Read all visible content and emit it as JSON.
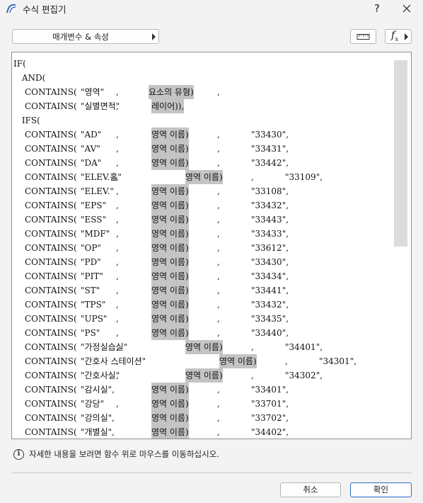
{
  "window": {
    "title": "수식 편집기",
    "help_glyph": "?"
  },
  "toolbar": {
    "params_label": "매개변수 & 속성",
    "units_icon": "ruler-icon",
    "fx_icon": "function-icon"
  },
  "code": [
    {
      "segments": [
        "IF("
      ]
    },
    {
      "segments": [
        " AND("
      ]
    },
    {
      "segments": [
        "CONTAINS(",
        "\"영역\"",
        ",",
        "요소의 유형)",
        ","
      ],
      "hl": [
        3
      ]
    },
    {
      "segments": [
        "CONTAINS(",
        "\"실별면적\"",
        ",",
        "레이어)),"
      ],
      "hl": [
        3
      ]
    },
    {
      "segments": [
        " IFS("
      ]
    },
    {
      "segments": [
        "CONTAINS(",
        "\"AD\"",
        ",",
        "영역 이름)",
        ",",
        "\"33430\","
      ],
      "hl": [
        3
      ]
    },
    {
      "segments": [
        "CONTAINS(",
        "\"AV\"",
        ",",
        "영역 이름)",
        ",",
        "\"33431\","
      ],
      "hl": [
        3
      ]
    },
    {
      "segments": [
        "CONTAINS(",
        "\"DA\"",
        ",",
        "영역 이름)",
        ",",
        "\"33442\","
      ],
      "hl": [
        3
      ]
    },
    {
      "segments": [
        "CONTAINS(",
        "\"ELEV.홀\"",
        ",",
        "영역 이름)",
        ",",
        "\"33109\","
      ],
      "hl": [
        3
      ]
    },
    {
      "segments": [
        "CONTAINS(",
        "\"ELEV.\"",
        ",",
        "영역 이름)",
        ",",
        "\"33108\","
      ],
      "hl": [
        3
      ]
    },
    {
      "segments": [
        "CONTAINS(",
        "\"EPS\"",
        ",",
        "영역 이름)",
        ",",
        "\"33432\","
      ],
      "hl": [
        3
      ]
    },
    {
      "segments": [
        "CONTAINS(",
        "\"ESS\"",
        ",",
        "영역 이름)",
        ",",
        "\"33443\","
      ],
      "hl": [
        3
      ]
    },
    {
      "segments": [
        "CONTAINS(",
        "\"MDF\"",
        ",",
        "영역 이름)",
        ",",
        "\"33433\","
      ],
      "hl": [
        3
      ]
    },
    {
      "segments": [
        "CONTAINS(",
        "\"OP\"",
        ",",
        "영역 이름)",
        ",",
        "\"33612\","
      ],
      "hl": [
        3
      ]
    },
    {
      "segments": [
        "CONTAINS(",
        "\"PD\"",
        ",",
        "영역 이름)",
        ",",
        "\"33430\","
      ],
      "hl": [
        3
      ]
    },
    {
      "segments": [
        "CONTAINS(",
        "\"PIT\"",
        ",",
        "영역 이름)",
        ",",
        "\"33434\","
      ],
      "hl": [
        3
      ]
    },
    {
      "segments": [
        "CONTAINS(",
        "\"ST\"",
        ",",
        "영역 이름)",
        ",",
        "\"33441\","
      ],
      "hl": [
        3
      ]
    },
    {
      "segments": [
        "CONTAINS(",
        "\"TPS\"",
        ",",
        "영역 이름)",
        ",",
        "\"33432\","
      ],
      "hl": [
        3
      ]
    },
    {
      "segments": [
        "CONTAINS(",
        "\"UPS\"",
        ",",
        "영역 이름)",
        ",",
        "\"33435\","
      ],
      "hl": [
        3
      ]
    },
    {
      "segments": [
        "CONTAINS(",
        "\"PS\"",
        ",",
        "영역 이름)",
        ",",
        "\"33440\","
      ],
      "hl": [
        3
      ]
    },
    {
      "segments": [
        "CONTAINS(",
        "\"가정실습실\"",
        ",",
        "영역 이름)",
        ",",
        "\"34401\","
      ],
      "hl": [
        3
      ]
    },
    {
      "segments": [
        "CONTAINS(",
        "\"간호사 스테이션\"",
        ",",
        "영역 이름)",
        ",",
        "\"34301\","
      ],
      "hl": [
        3
      ]
    },
    {
      "segments": [
        "CONTAINS(",
        "\"간호사실\"",
        ",",
        "영역 이름)",
        ",",
        "\"34302\","
      ],
      "hl": [
        3
      ]
    },
    {
      "segments": [
        "CONTAINS(",
        "\"감시실\",",
        "",
        "영역 이름)",
        ",",
        "\"33401\","
      ],
      "hl": [
        3
      ]
    },
    {
      "segments": [
        "CONTAINS(",
        "\"강당\"",
        ",",
        "영역 이름)",
        ",",
        "\"33701\","
      ],
      "hl": [
        3
      ]
    },
    {
      "segments": [
        "CONTAINS(",
        "\"강의실\",",
        "",
        "영역 이름)",
        ",",
        "\"33702\","
      ],
      "hl": [
        3
      ]
    },
    {
      "segments": [
        "CONTAINS(",
        "\"개별실\",",
        "",
        "영역 이름)",
        ",",
        "\"34402\","
      ],
      "hl": [
        3
      ]
    }
  ],
  "info": {
    "icon": "info-icon",
    "text": "자세한 내용을 보려면 함수 위로 마우스를 이동하십시오."
  },
  "buttons": {
    "cancel": "취소",
    "ok": "확인"
  },
  "colors": {
    "highlight": "#c4c4c4",
    "ok_border": "#2d6cc6"
  }
}
